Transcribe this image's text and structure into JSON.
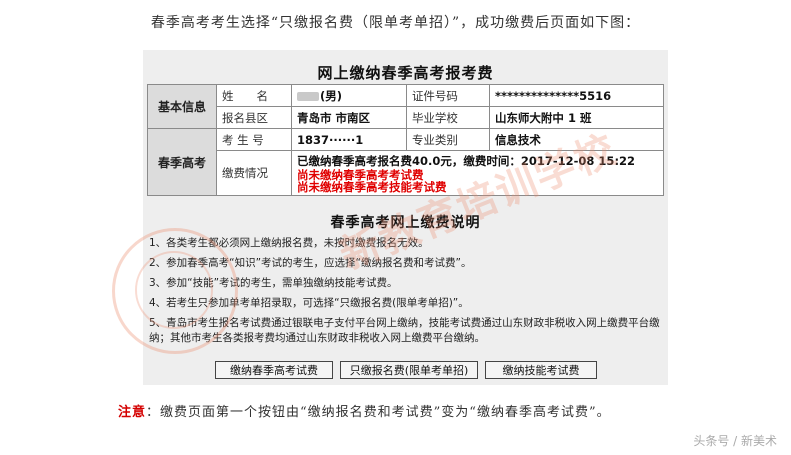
{
  "intro": "春季高考考生选择“只缴报名费（限单考单招）”，成功缴费后页面如下图：",
  "form": {
    "title": "网上缴纳春季高考报考费",
    "sections": {
      "basic": "基本信息",
      "spring": "春季高考"
    },
    "fields": {
      "name_label": "姓　　名",
      "name_suffix": "(男)",
      "id_label": "证件号码",
      "id_value": "**************5516",
      "county_label": "报名县区",
      "county_value": "青岛市 市南区",
      "school_label": "毕业学校",
      "school_value": "山东师大附中 1 班",
      "exam_no_label": "考 生 号",
      "exam_no_value": "1837······1",
      "major_label": "专业类别",
      "major_value": "信息技术",
      "pay_label": "缴费情况",
      "pay_paid": "已缴纳春季高考报名费40.0元，缴费时间：2017-12-08 15:22",
      "pay_unpaid_1": "尚未缴纳春季高考考试费",
      "pay_unpaid_2": "尚未缴纳春季高考技能考试费"
    },
    "notes_title": "春季高考网上缴费说明",
    "notes": [
      "1、各类考生都必须网上缴纳报名费，未按时缴费报名无效。",
      "2、参加春季高考“知识”考试的考生，应选择“缴纳报名费和考试费”。",
      "3、参加“技能”考试的考生，需单独缴纳技能考试费。",
      "4、若考生只参加单考单招录取，可选择“只缴报名费(限单考单招)”。",
      "5、青岛市考生报名考试费通过银联电子支付平台网上缴纳，技能考试费通过山东财政非税收入网上缴费平台缴纳；其他市考生各类报考费均通过山东财政非税收入网上缴费平台缴纳。"
    ],
    "buttons": {
      "pay_spring": "缴纳春季高考试费",
      "pay_reg_only": "只缴报名费(限单考单招)",
      "pay_skill": "缴纳技能考试费"
    }
  },
  "note_bottom": {
    "prefix": "注意",
    "text": "：缴费页面第一个按钮由“缴纳报名费和考试费”变为“缴纳春季高考试费”。"
  },
  "watermark": "新教育培训学校",
  "footer": "头条号 / 新美术",
  "colors": {
    "accent_red": "#e00000",
    "panel_bg": "#eeeeee",
    "watermark": "#eb8c6e"
  }
}
